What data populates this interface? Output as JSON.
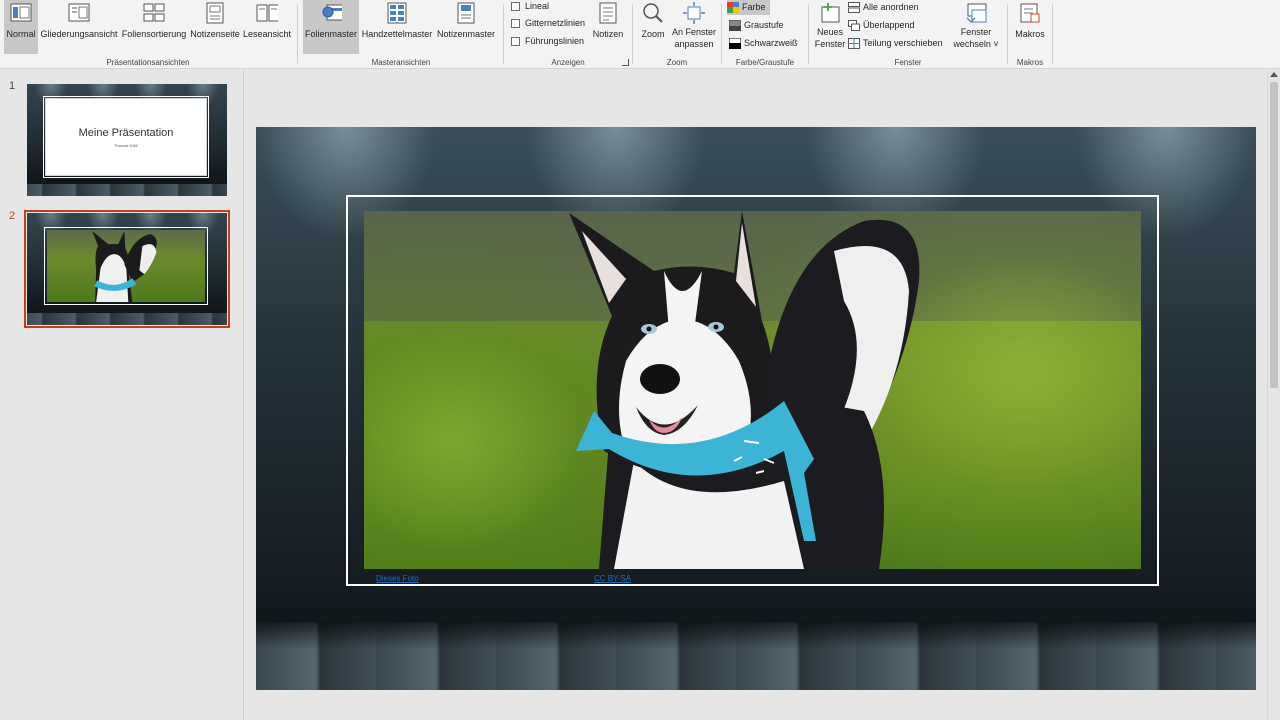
{
  "ribbon": {
    "groups": {
      "praesentationsansichten": {
        "label": "Präsentationsansichten",
        "buttons": [
          "Normal",
          "Gliederungsansicht",
          "Foliensortierung",
          "Notizenseite",
          "Leseansicht"
        ]
      },
      "masteransichten": {
        "label": "Masteransichten",
        "buttons": [
          "Folienmaster",
          "Handzettelmaster",
          "Notizenmaster"
        ]
      },
      "anzeigen": {
        "label": "Anzeigen",
        "checkboxes": [
          "Lineal",
          "Gitternetzlinien",
          "Führungslinien"
        ],
        "notizen": "Notizen"
      },
      "zoom": {
        "label": "Zoom",
        "zoom": "Zoom",
        "fit_line1": "An Fenster",
        "fit_line2": "anpassen"
      },
      "farbe": {
        "label": "Farbe/Graustufe",
        "items": [
          "Farbe",
          "Graustufe",
          "Schwarzweiß"
        ]
      },
      "fenster": {
        "label": "Fenster",
        "neues_line1": "Neues",
        "neues_line2": "Fenster",
        "small": [
          "Alle anordnen",
          "Überlappend",
          "Teilung verschieben"
        ],
        "wechseln_line1": "Fenster",
        "wechseln_line2": "wechseln ˅"
      },
      "makros": {
        "label": "Makros",
        "button": "Makros"
      }
    }
  },
  "thumbnails": [
    {
      "number": "1",
      "title": "Meine Präsentation",
      "subtitle": "Thomas Kößl"
    },
    {
      "number": "2"
    }
  ],
  "slide": {
    "credit_left": "Dieses Foto",
    "credit_right": "CC BY-SA"
  },
  "colors": {
    "accent": "#c43e1c",
    "link": "#2e69b0",
    "ribbon_bg": "#f3f3f3"
  }
}
